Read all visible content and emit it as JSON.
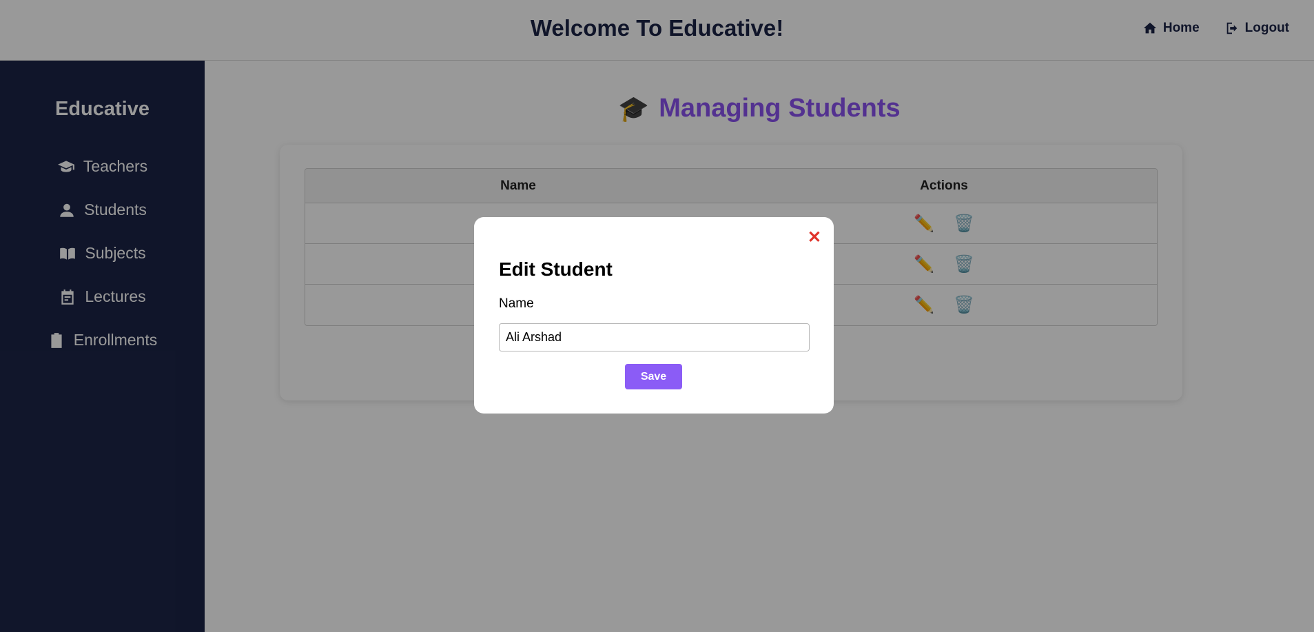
{
  "header": {
    "title": "Welcome To Educative!",
    "nav": [
      {
        "label": "Home",
        "icon": "home-icon"
      },
      {
        "label": "Logout",
        "icon": "logout-icon"
      }
    ]
  },
  "sidebar": {
    "brand": "Educative",
    "items": [
      {
        "label": "Teachers",
        "icon": "graduation-cap-icon"
      },
      {
        "label": "Students",
        "icon": "user-icon"
      },
      {
        "label": "Subjects",
        "icon": "book-icon"
      },
      {
        "label": "Lectures",
        "icon": "calendar-icon"
      },
      {
        "label": "Enrollments",
        "icon": "clipboard-icon"
      }
    ]
  },
  "main": {
    "heading": "Managing Students",
    "heading_icon": "🎓",
    "table": {
      "columns": [
        "Name",
        "Actions"
      ],
      "row_count": 3,
      "edit_icon": "✏️",
      "delete_icon": "🗑️"
    }
  },
  "modal": {
    "title": "Edit Student",
    "close_symbol": "✕",
    "field_label": "Name",
    "field_value": "Ali Arshad",
    "save_label": "Save"
  },
  "colors": {
    "navy": "#1c2447",
    "accent": "#8b5cf6",
    "close": "#e0332a"
  }
}
